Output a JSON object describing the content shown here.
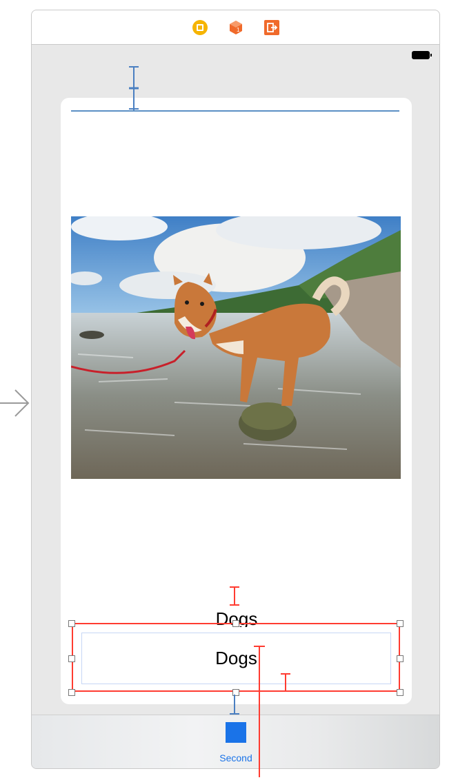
{
  "scene": {
    "dock_icons": [
      "view-controller-icon",
      "first-responder-icon",
      "exit-icon"
    ],
    "status_bar": {
      "battery_icon": "battery-icon"
    }
  },
  "content": {
    "image": {
      "subject": "dog-photo"
    },
    "label_top": "Dogs",
    "label_selected": "Dogs"
  },
  "tab_bar": {
    "items": [
      {
        "label": "Second",
        "icon": "square-icon",
        "color": "#1a73e8"
      }
    ]
  },
  "colors": {
    "constraint_blue": "#4a7fc1",
    "constraint_red": "#ff3b30",
    "tint": "#1a73e8",
    "dock_yellow": "#f6b400",
    "dock_orange": "#f06a2b"
  }
}
